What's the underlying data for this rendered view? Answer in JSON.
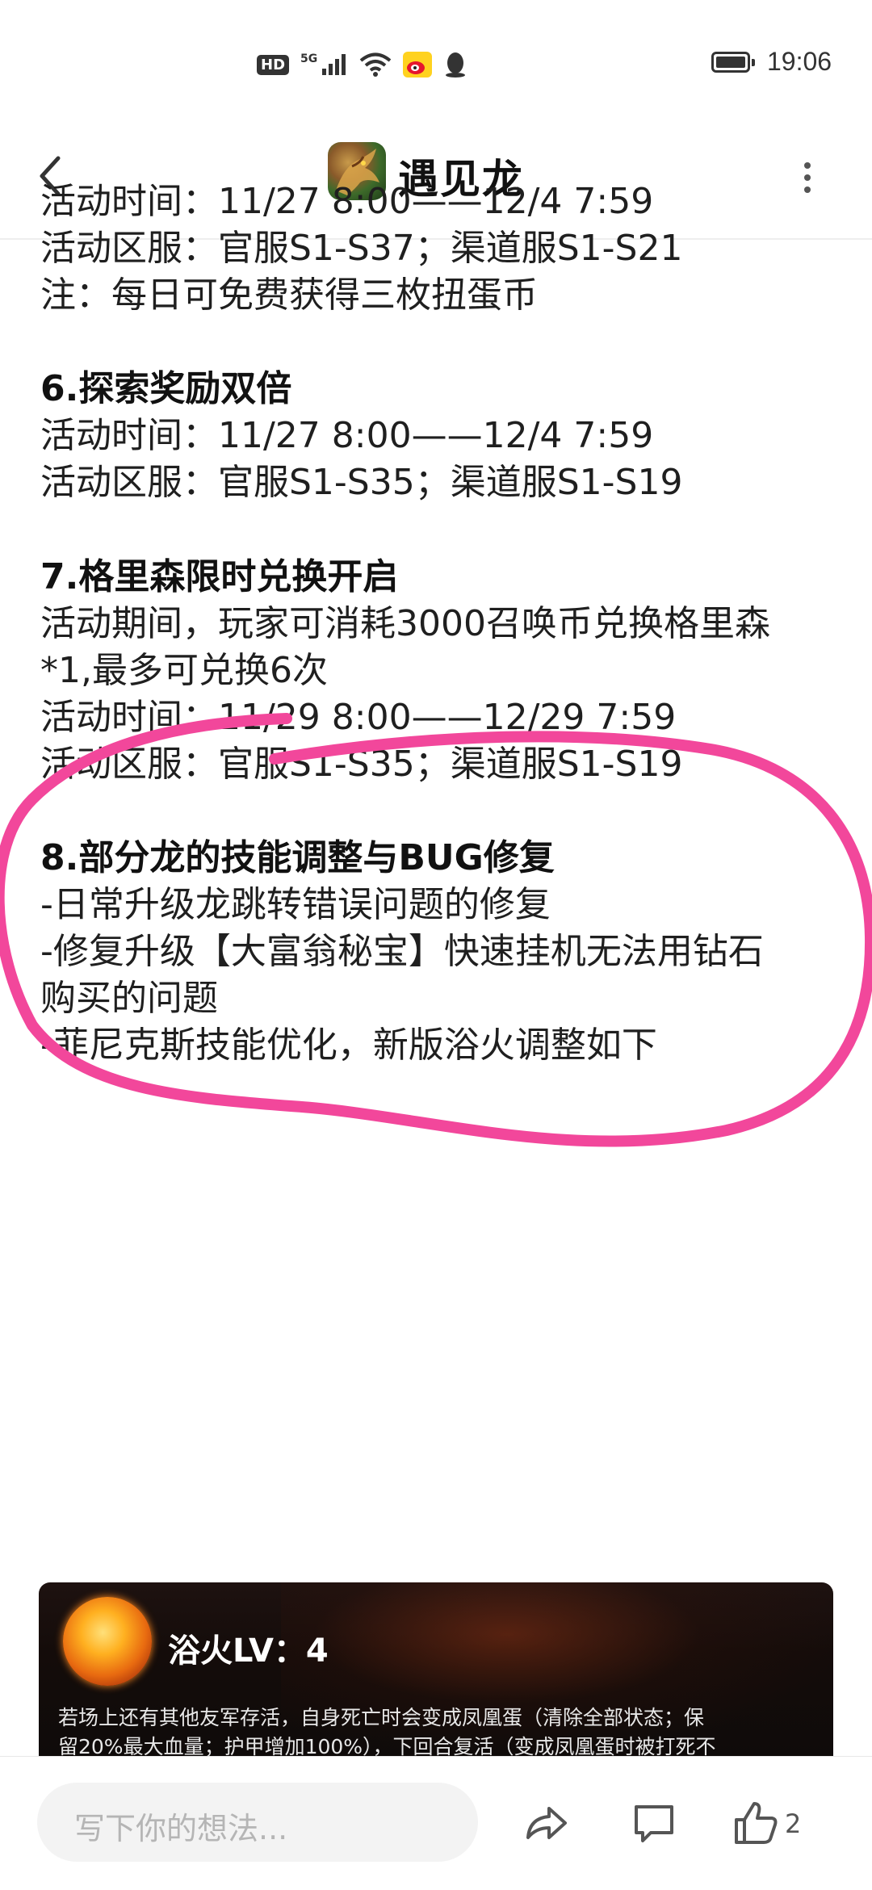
{
  "status_bar": {
    "network_badge": "HD",
    "signal_label": "5G",
    "time": "19:06"
  },
  "header": {
    "title": "遇见龙",
    "icons": [
      "back-arrow-icon",
      "app-logo",
      "more-dots-icon"
    ]
  },
  "content": {
    "lines": [
      "活动时间：11/27 8:00——12/4 7:59",
      "活动区服：官服S1-S37；渠道服S1-S21",
      "注：每日可免费获得三枚扭蛋币",
      "6.探索奖励双倍",
      "活动时间：11/27 8:00——12/4 7:59",
      "活动区服：官服S1-S35；渠道服S1-S19",
      "7.格里森限时兑换开启",
      "活动期间，玩家可消耗3000召唤币兑换格里森",
      "*1,最多可兑换6次",
      "活动时间：11/29 8:00——12/29 7:59",
      "活动区服：官服S1-S35；渠道服S1-S19",
      "8.部分龙的技能调整与BUG修复",
      "-日常升级龙跳转错误问题的修复",
      "-修复升级【大富翁秘宝】快速挂机无法用钻石",
      "购买的问题",
      "-菲尼克斯技能优化，新版浴火调整如下"
    ]
  },
  "game_image": {
    "skill_title": "浴火LV：4",
    "skill_desc_line1": "若场上还有其他友军存活，自身死亡时会变成凤凰蛋（清除全部状态；保",
    "skill_desc_line2": "留20%最大血量；护甲增加100%），下回合复活（变成凤凰蛋时被打死不"
  },
  "bottom_bar": {
    "comment_placeholder": "写下你的想法...",
    "like_count": "2",
    "icons": [
      "share-icon",
      "comment-icon",
      "like-icon"
    ]
  },
  "colors": {
    "annotation_pink": "#f2479b",
    "text": "#1f1f1f",
    "placeholder": "#b5b5b5"
  }
}
